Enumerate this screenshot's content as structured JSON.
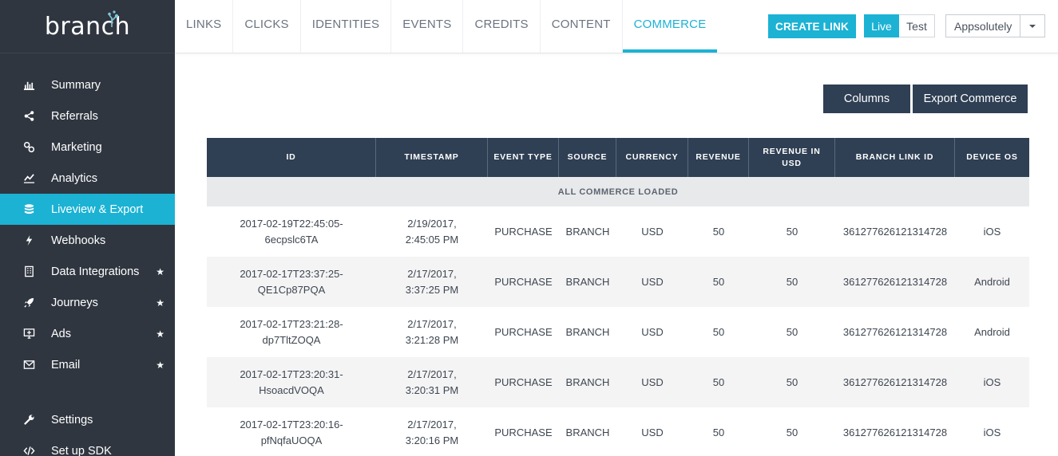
{
  "brand": {
    "logo_text": "branch",
    "accent": "#1bb2d4",
    "sidebar_bg": "#2f3640",
    "header_bg": "#2f3f54"
  },
  "sidebar": {
    "items": [
      {
        "label": "Summary",
        "icon": "bar-chart-icon",
        "starred": false,
        "active": false
      },
      {
        "label": "Referrals",
        "icon": "share-icon",
        "starred": false,
        "active": false
      },
      {
        "label": "Marketing",
        "icon": "link-icon",
        "starred": false,
        "active": false
      },
      {
        "label": "Analytics",
        "icon": "line-chart-icon",
        "starred": false,
        "active": false
      },
      {
        "label": "Liveview & Export",
        "icon": "database-icon",
        "starred": false,
        "active": true
      },
      {
        "label": "Webhooks",
        "icon": "bolt-icon",
        "starred": false,
        "active": false
      },
      {
        "label": "Data Integrations",
        "icon": "building-icon",
        "starred": true,
        "active": false
      },
      {
        "label": "Journeys",
        "icon": "rocket-icon",
        "starred": true,
        "active": false
      },
      {
        "label": "Ads",
        "icon": "monitor-icon",
        "starred": true,
        "active": false
      },
      {
        "label": "Email",
        "icon": "envelope-icon",
        "starred": true,
        "active": false
      }
    ],
    "bottom_items": [
      {
        "label": "Settings",
        "icon": "wrench-icon"
      },
      {
        "label": "Set up SDK",
        "icon": "code-icon"
      }
    ],
    "star_glyph": "★"
  },
  "topnav": {
    "tabs": [
      {
        "label": "LINKS",
        "active": false
      },
      {
        "label": "CLICKS",
        "active": false
      },
      {
        "label": "IDENTITIES",
        "active": false
      },
      {
        "label": "EVENTS",
        "active": false
      },
      {
        "label": "CREDITS",
        "active": false
      },
      {
        "label": "CONTENT",
        "active": false
      },
      {
        "label": "COMMERCE",
        "active": true
      }
    ],
    "create_link_label": "CREATE LINK",
    "env_live": "Live",
    "env_test": "Test",
    "app_name": "Appsolutely"
  },
  "actions": {
    "columns_label": "Columns",
    "export_label": "Export Commerce"
  },
  "table": {
    "headers": [
      "ID",
      "TIMESTAMP",
      "EVENT TYPE",
      "SOURCE",
      "CURRENCY",
      "REVENUE",
      "REVENUE IN USD",
      "BRANCH LINK ID",
      "DEVICE OS"
    ],
    "loaded_message": "ALL COMMERCE LOADED",
    "rows": [
      [
        "2017-02-19T22:45:05-6ecpslc6TA",
        "2/19/2017, 2:45:05 PM",
        "PURCHASE",
        "BRANCH",
        "USD",
        "50",
        "50",
        "361277626121314728",
        "iOS"
      ],
      [
        "2017-02-17T23:37:25-QE1Cp87PQA",
        "2/17/2017, 3:37:25 PM",
        "PURCHASE",
        "BRANCH",
        "USD",
        "50",
        "50",
        "361277626121314728",
        "Android"
      ],
      [
        "2017-02-17T23:21:28-dp7TltZOQA",
        "2/17/2017, 3:21:28 PM",
        "PURCHASE",
        "BRANCH",
        "USD",
        "50",
        "50",
        "361277626121314728",
        "Android"
      ],
      [
        "2017-02-17T23:20:31-HsoacdVOQA",
        "2/17/2017, 3:20:31 PM",
        "PURCHASE",
        "BRANCH",
        "USD",
        "50",
        "50",
        "361277626121314728",
        "iOS"
      ],
      [
        "2017-02-17T23:20:16-pfNqfaUOQA",
        "2/17/2017, 3:20:16 PM",
        "PURCHASE",
        "BRANCH",
        "USD",
        "50",
        "50",
        "361277626121314728",
        "iOS"
      ]
    ]
  }
}
